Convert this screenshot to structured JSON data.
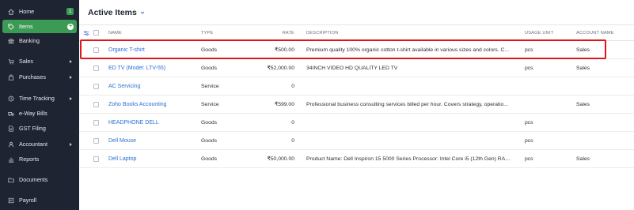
{
  "sidebar": {
    "items": [
      {
        "label": "Home",
        "icon": "home-icon",
        "badge": "1"
      },
      {
        "label": "Items",
        "icon": "tag-icon",
        "active": true
      },
      {
        "label": "Banking",
        "icon": "bank-icon"
      },
      {
        "label": "Sales",
        "icon": "cart-icon",
        "caret": true
      },
      {
        "label": "Purchases",
        "icon": "bag-icon",
        "caret": true
      },
      {
        "label": "Time Tracking",
        "icon": "clock-icon",
        "caret": true
      },
      {
        "label": "e-Way Bills",
        "icon": "truck-icon"
      },
      {
        "label": "GST Filing",
        "icon": "file-icon"
      },
      {
        "label": "Accountant",
        "icon": "person-icon",
        "caret": true
      },
      {
        "label": "Reports",
        "icon": "chart-icon"
      },
      {
        "label": "Documents",
        "icon": "folder-icon"
      },
      {
        "label": "Payroll",
        "icon": "payroll-icon"
      }
    ]
  },
  "header": {
    "title": "Active Items"
  },
  "table": {
    "columns": {
      "name": "NAME",
      "type": "TYPE",
      "rate": "RATE",
      "description": "DESCRIPTION",
      "unit": "USAGE UNIT",
      "account": "ACCOUNT NAME"
    },
    "rows": [
      {
        "name": "Organic T-shirt",
        "type": "Goods",
        "rate": "₹500.00",
        "description": "Premium quality 100% organic cotton t-shirt available in various sizes and colors. C...",
        "unit": "pcs",
        "account": "Sales"
      },
      {
        "name": "ED TV (Model: LTV-55)",
        "type": "Goods",
        "rate": "₹52,000.00",
        "description": "34INCH VIDEO HD QUALITY LED TV",
        "unit": "pcs",
        "account": "Sales"
      },
      {
        "name": "AC Servicing",
        "type": "Service",
        "rate": "0",
        "description": "",
        "unit": "",
        "account": ""
      },
      {
        "name": "Zoho Books Accounting",
        "type": "Service",
        "rate": "₹599.00",
        "description": "Professional business consulting services billed per hour. Covers strategy, operatio...",
        "unit": "",
        "account": "Sales"
      },
      {
        "name": "HEADPHONE DELL",
        "type": "Goods",
        "rate": "0",
        "description": "",
        "unit": "pcs",
        "account": ""
      },
      {
        "name": "Dell Mouse",
        "type": "Goods",
        "rate": "0",
        "description": "",
        "unit": "pcs",
        "account": ""
      },
      {
        "name": "Dell Laptop",
        "type": "Goods",
        "rate": "₹50,000.00",
        "description": "Product Name: Dell Inspiron 15 5000 Series Processor: Intel Core i5 (12th Gen) RAM...",
        "unit": "pcs",
        "account": "Sales"
      }
    ]
  },
  "colors": {
    "sidebar_bg": "#1f2432",
    "active": "#3b9b54",
    "link": "#2a6fd6",
    "highlight": "#e0141b"
  }
}
